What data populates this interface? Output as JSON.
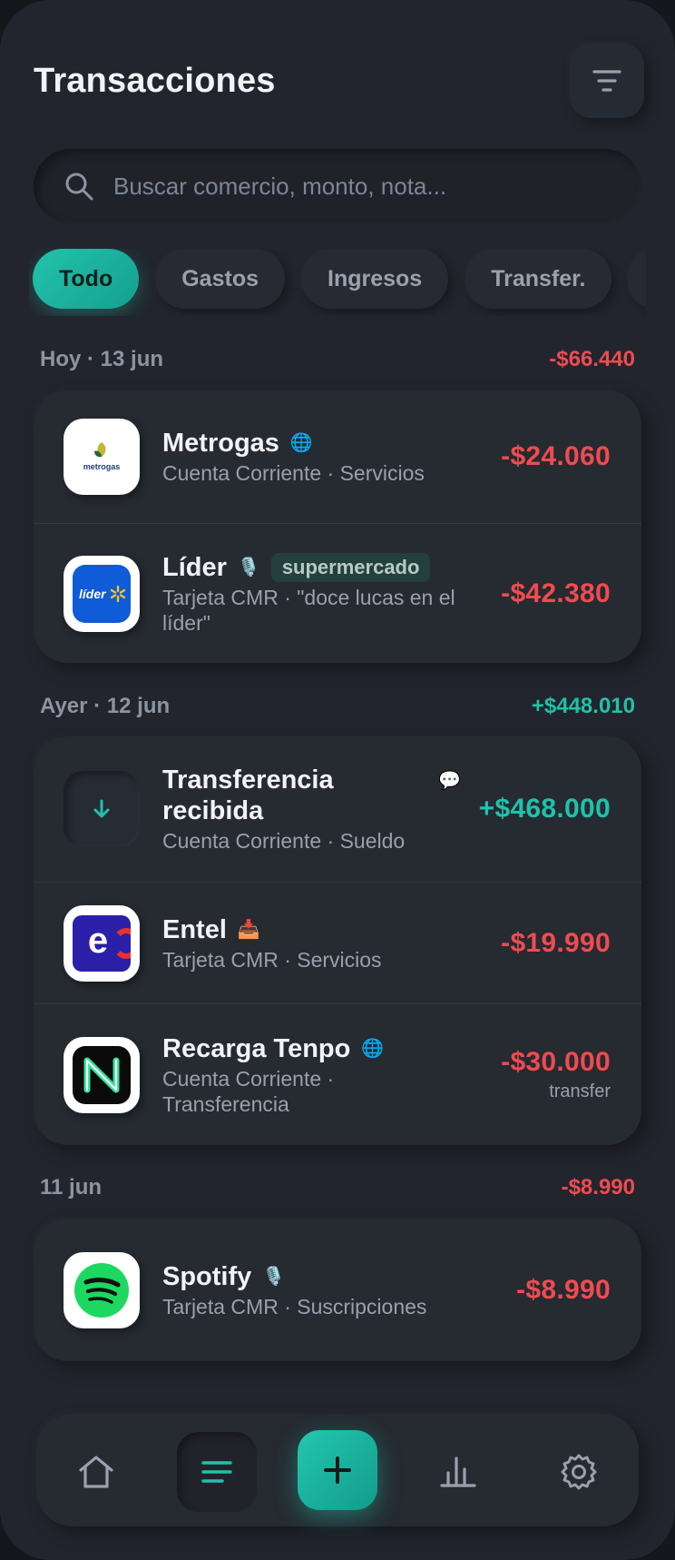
{
  "header": {
    "title": "Transacciones",
    "filter_icon": "filter-icon"
  },
  "search": {
    "placeholder": "Buscar comercio, monto, nota...",
    "value": ""
  },
  "chips": [
    {
      "label": "Todo",
      "active": true
    },
    {
      "label": "Gastos",
      "active": false
    },
    {
      "label": "Ingresos",
      "active": false
    },
    {
      "label": "Transfer.",
      "active": false
    }
  ],
  "groups": [
    {
      "date": "Hoy · 13 jun",
      "total": "-$66.440",
      "items": [
        {
          "name": "Metrogas",
          "badge_icon": "🌐",
          "subtitle": "Cuenta Corriente · Servicios",
          "amount": "-$24.060",
          "logo_text": "metrogas"
        },
        {
          "name": "Líder",
          "badge_icon": "🎙️",
          "tag": "supermercado",
          "subtitle": "Tarjeta CMR · \"doce lucas en el líder\"",
          "amount": "-$42.380",
          "logo_text": "líder"
        }
      ]
    },
    {
      "date": "Ayer · 12 jun",
      "total": "+$448.010",
      "items": [
        {
          "name": "Transferencia recibida",
          "badge_icon": "💬",
          "subtitle": "Cuenta Corriente · Sueldo",
          "amount": "+$468.000"
        },
        {
          "name": "Entel",
          "badge_icon": "📥",
          "subtitle": "Tarjeta CMR · Servicios",
          "amount": "-$19.990"
        },
        {
          "name": "Recarga Tenpo",
          "badge_icon": "🌐",
          "subtitle": "Cuenta Corriente · Transferencia",
          "amount": "-$30.000",
          "note": "transfer"
        }
      ]
    },
    {
      "date": "11 jun",
      "total": "-$8.990",
      "items": [
        {
          "name": "Spotify",
          "badge_icon": "🎙️",
          "subtitle": "Tarjeta CMR · Suscripciones",
          "amount": "-$8.990"
        }
      ]
    }
  ],
  "nav": {
    "items": [
      "home-icon",
      "list-icon",
      "add-icon",
      "chart-icon",
      "settings-icon"
    ],
    "active": "list-icon"
  },
  "colors": {
    "accent": "#20c1aa",
    "negative": "#ef4b50",
    "background": "#22252d"
  }
}
